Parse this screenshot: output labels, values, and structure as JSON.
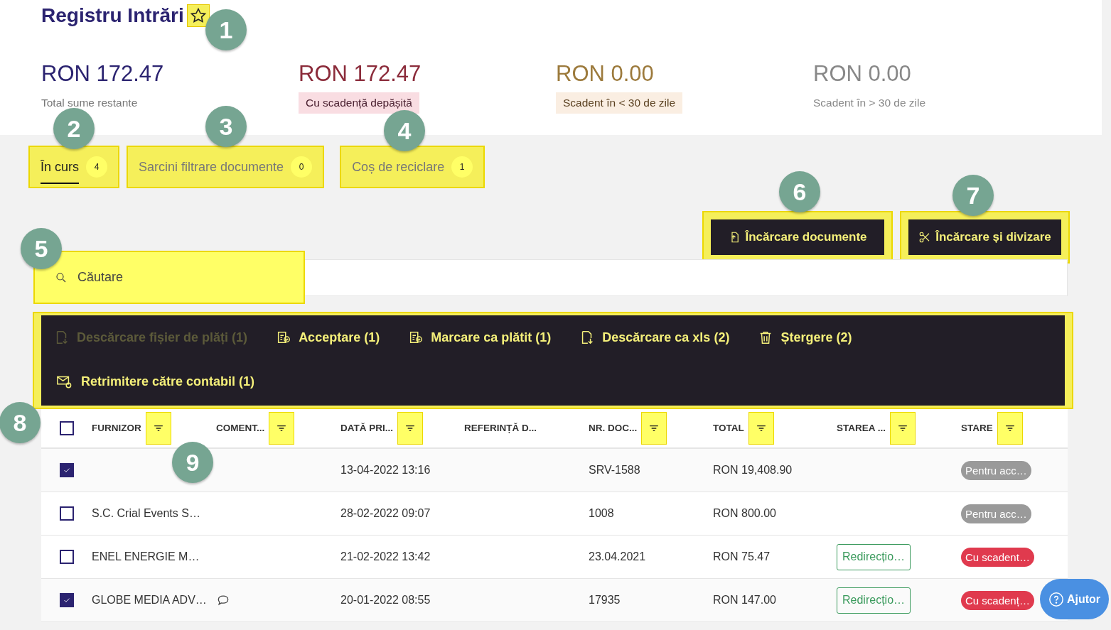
{
  "header": {
    "title": "Registru Intrări",
    "favorite": false
  },
  "summary": [
    {
      "kind": "total",
      "amount": "RON 172.47",
      "label": "Total sume restante"
    },
    {
      "kind": "overdue",
      "amount": "RON 172.47",
      "label": "Cu scadență depășită"
    },
    {
      "kind": "soon",
      "amount": "RON 0.00",
      "label": "Scadent în < 30 de zile"
    },
    {
      "kind": "later",
      "amount": "RON 0.00",
      "label": "Scadent în > 30 de zile"
    }
  ],
  "tabs": [
    {
      "label": "În curs",
      "count": "4",
      "selected": true
    },
    {
      "label": "Sarcini filtrare documente",
      "count": "0",
      "selected": false
    },
    {
      "label": "Coș de reciclare",
      "count": "1",
      "selected": false
    }
  ],
  "buttons": [
    {
      "kind": "upload",
      "label": "Încărcare documente"
    },
    {
      "kind": "split",
      "label": "Încărcare și divizare"
    }
  ],
  "search": {
    "placeholder": "Căutare"
  },
  "actions": [
    {
      "kind": "download",
      "label": "Descărcare fișier de plăți (1)",
      "disabled": true
    },
    {
      "kind": "accept",
      "label": "Acceptare (1)",
      "disabled": false
    },
    {
      "kind": "accept",
      "label": "Marcare ca plătit (1)",
      "disabled": false
    },
    {
      "kind": "download",
      "label": "Descărcare ca xls (2)",
      "disabled": false
    },
    {
      "kind": "delete",
      "label": "Ștergere (2)",
      "disabled": false
    },
    {
      "kind": "mail",
      "label": "Retrimitere către contabil (1)",
      "disabled": false
    }
  ],
  "table": {
    "all_checked": false,
    "columns": [
      {
        "label": "FURNIZOR",
        "filter": true
      },
      {
        "label": "COMENT...",
        "filter": true
      },
      {
        "label": "DATĂ PRI...",
        "filter": true
      },
      {
        "label": "REFERINȚĂ D...",
        "filter": false
      },
      {
        "label": "NR. DOC...",
        "filter": true
      },
      {
        "label": "TOTAL",
        "filter": true
      },
      {
        "label": "STAREA ...",
        "filter": true
      },
      {
        "label": "STARE",
        "filter": true
      }
    ],
    "rows": [
      {
        "checked": true,
        "supplier": "",
        "comment": false,
        "date": "13-04-2022 13:16",
        "reference": "",
        "doc_no": "SRV-1588",
        "total": "RON 19,408.90",
        "forward": "",
        "status": "Pentru acc…",
        "kind": "pending"
      },
      {
        "checked": false,
        "supplier": "S.C. Crial Events S…",
        "comment": false,
        "date": "28-02-2022 09:07",
        "reference": "",
        "doc_no": "1008",
        "total": "RON 800.00",
        "forward": "",
        "status": "Pentru acc…",
        "kind": "pending"
      },
      {
        "checked": false,
        "supplier": "ENEL ENERGIE M…",
        "comment": false,
        "date": "21-02-2022 13:42",
        "reference": "",
        "doc_no": "23.04.2021",
        "total": "RON 75.47",
        "forward": "Redirecțio…",
        "status": "Cu scadent…",
        "kind": "overdue"
      },
      {
        "checked": true,
        "supplier": "GLOBE MEDIA ADV…",
        "comment": true,
        "date": "20-01-2022 08:55",
        "reference": "",
        "doc_no": "17935",
        "total": "RON 147.00",
        "forward": "Redirecțio…",
        "status": "Cu scadenț…",
        "kind": "overdue"
      }
    ]
  },
  "help": {
    "label": "Ajutor"
  },
  "annotations": [
    "1",
    "2",
    "3",
    "4",
    "5",
    "6",
    "7",
    "8",
    "9"
  ]
}
